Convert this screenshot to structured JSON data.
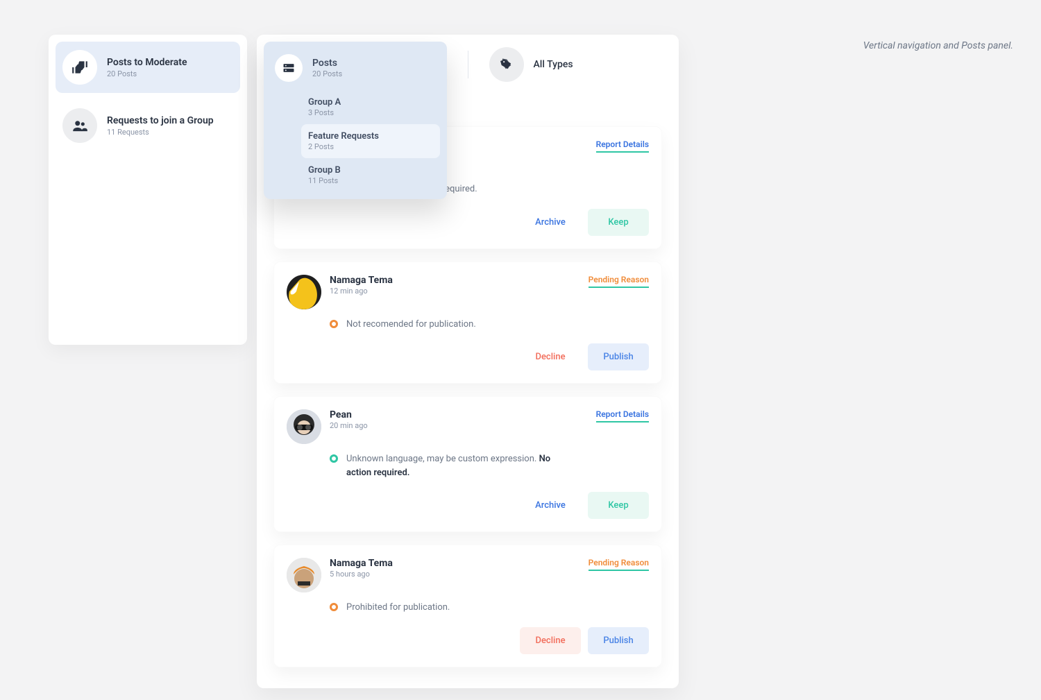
{
  "annotation": "Vertical navigation and Posts panel.",
  "sidebar": {
    "items": [
      {
        "title": "Posts to Moderate",
        "sub": "20 Posts",
        "active": true
      },
      {
        "title": "Requests to join a Group",
        "sub": "11 Requests",
        "active": false
      }
    ]
  },
  "filters": {
    "posts": {
      "label": "Posts",
      "sub": "20 Posts"
    },
    "types": {
      "label": "All Types"
    }
  },
  "dropdown": {
    "title": "Posts",
    "sub": "20 Posts",
    "items": [
      {
        "title": "Group A",
        "sub": "3 Posts",
        "selected": false
      },
      {
        "title": "Feature Requests",
        "sub": "2 Posts",
        "selected": true
      },
      {
        "title": "Group B",
        "sub": "11 Posts",
        "selected": false
      }
    ]
  },
  "posts": [
    {
      "name": "",
      "time": "",
      "link": "Report Details",
      "linkType": "report",
      "status": "ok",
      "message_suffix": "on required.",
      "secondary": "Archive",
      "primary": "Keep"
    },
    {
      "name": "Namaga Tema",
      "time": "12 min ago",
      "link": "Pending Reason",
      "linkType": "pending",
      "status": "warn",
      "message": "Not recomended for publication.",
      "secondary": "Decline",
      "primary": "Publish"
    },
    {
      "name": "Pean",
      "time": "20 min ago",
      "link": "Report Details",
      "linkType": "report",
      "status": "ok",
      "message": "Unknown language, may be custom expression. ",
      "message_bold": "No action required.",
      "secondary": "Archive",
      "primary": "Keep"
    },
    {
      "name": "Namaga Tema",
      "time": "5 hours ago",
      "link": "Pending Reason",
      "linkType": "pending",
      "status": "warn",
      "message": "Prohibited for publication.",
      "secondary": "Decline",
      "primary": "Publish",
      "secondaryFilled": true
    }
  ]
}
